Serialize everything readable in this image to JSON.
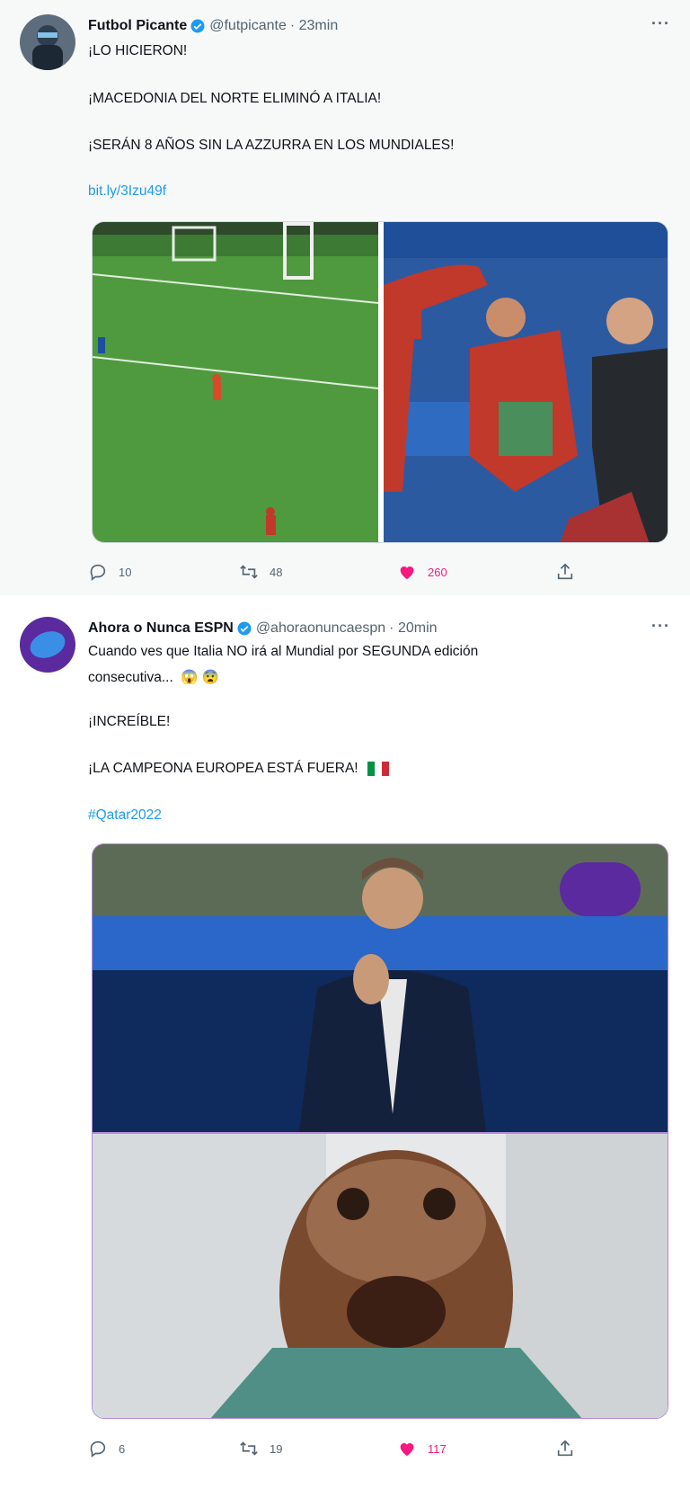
{
  "tweets": [
    {
      "name": "Futbol Picante",
      "handle": "@futpicante",
      "time": "· 23min",
      "lines": [
        "¡LO HICIERON!",
        "¡MACEDONIA DEL NORTE ELIMINÓ A ITALIA!",
        "¡SERÁN 8 AÑOS SIN LA AZZURRA EN LOS MUNDIALES!"
      ],
      "link": "bit.ly/3Izu49f",
      "actions": {
        "reply": "10",
        "retweet": "48",
        "like": "260"
      }
    },
    {
      "name": "Ahora o Nunca ESPN",
      "handle": "@ahoraonuncaespn",
      "time": "· 20min",
      "lines": [
        "Cuando ves que Italia NO irá al Mundial por SEGUNDA edición",
        "consecutiva...",
        "¡INCREÍBLE!",
        "¡LA CAMPEONA EUROPEA ESTÁ FUERA!"
      ],
      "hashtag": "#Qatar2022",
      "emojis": "😱 😨",
      "actions": {
        "reply": "6",
        "retweet": "19",
        "like": "117"
      }
    }
  ],
  "colors": {
    "accent": "#1d9bf0",
    "like": "#f91880",
    "muted": "#536471"
  }
}
